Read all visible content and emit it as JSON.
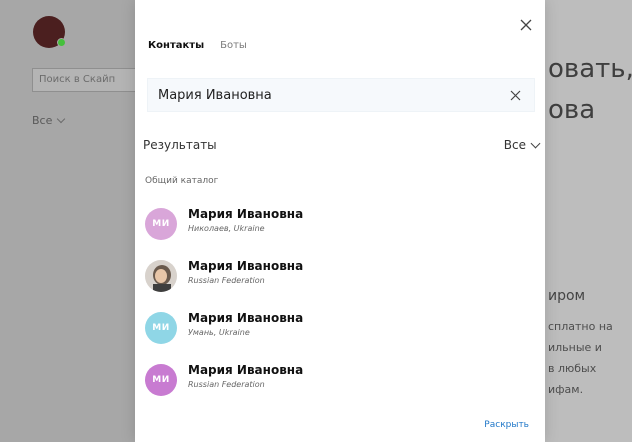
{
  "background": {
    "search_placeholder": "Поиск в Скайп",
    "filter_label": "Все",
    "right_text_1": "овать,",
    "right_text_2": "ова",
    "right_text_3": "иром",
    "right_small_lines": [
      "сплатно на",
      "ильные и",
      "в любых",
      "ифам."
    ]
  },
  "modal": {
    "tabs": [
      {
        "label": "Контакты",
        "active": true
      },
      {
        "label": "Боты",
        "active": false
      }
    ],
    "search": {
      "value": "Мария Ивановна"
    },
    "results_title": "Результаты",
    "results_filter": "Все",
    "catalog_label": "Общий каталог",
    "results": [
      {
        "name": "Мария Ивановна",
        "location": "Николаев, Ukraine",
        "avatar_text": "МИ",
        "avatar_color": "#d9a6d9",
        "avatar_type": "initials"
      },
      {
        "name": "Мария Ивановна",
        "location": "Russian Federation",
        "avatar_text": "",
        "avatar_color": "#7a6a5a",
        "avatar_type": "photo"
      },
      {
        "name": "Мария Ивановна",
        "location": "Умань, Ukraine",
        "avatar_text": "МИ",
        "avatar_color": "#8fd6e6",
        "avatar_type": "initials"
      },
      {
        "name": "Мария Ивановна",
        "location": "Russian Federation",
        "avatar_text": "МИ",
        "avatar_color": "#c87bd1",
        "avatar_type": "initials"
      }
    ],
    "expand_label": "Раскрыть"
  },
  "colors": {
    "accent": "#1f77c8",
    "presence_online": "#45c03c"
  }
}
